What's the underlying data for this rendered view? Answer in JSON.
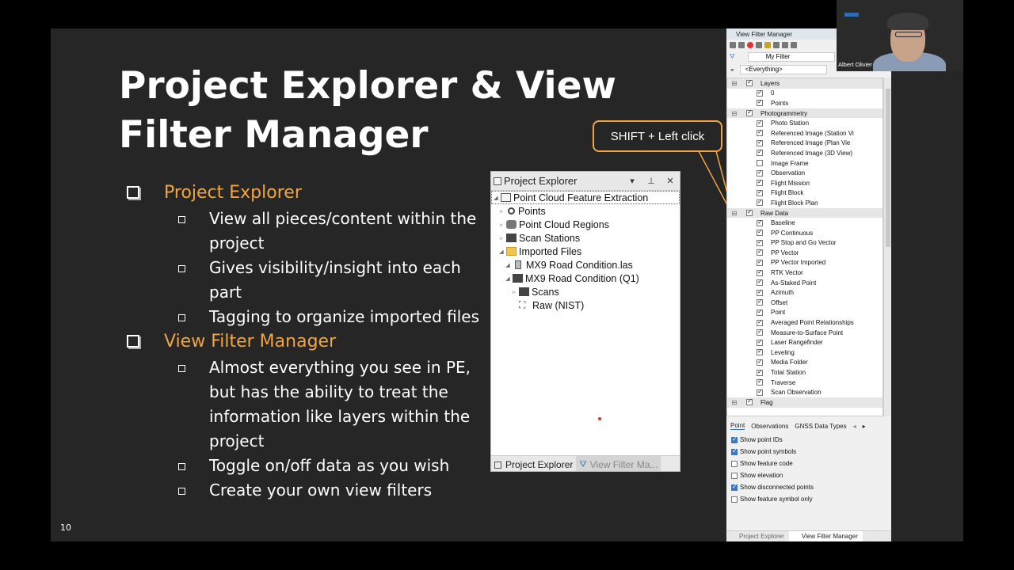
{
  "slide": {
    "title": "Project Explorer & View Filter Manager",
    "slide_number": "10",
    "bullets": [
      {
        "label": "Project Explorer",
        "items": [
          "View all pieces/content within the project",
          "Gives visibility/insight into each part",
          "Tagging to organize imported files"
        ]
      },
      {
        "label": "View Filter Manager",
        "items": [
          "Almost everything you see in PE, but has the ability to treat the information like layers within the project",
          "Toggle on/off data as you wish",
          "Create your own view filters"
        ]
      }
    ],
    "callout": "SHIFT + Left click"
  },
  "project_explorer": {
    "title": "Project Explorer",
    "controls": [
      "▾",
      "⊥",
      "✕"
    ],
    "tree": [
      {
        "label": "Point Cloud Feature Extraction",
        "icon": "document-icon"
      },
      {
        "label": "Points",
        "icon": "points-icon"
      },
      {
        "label": "Point Cloud Regions",
        "icon": "region-icon"
      },
      {
        "label": "Scan Stations",
        "icon": "scan-station-icon"
      },
      {
        "label": "Imported Files",
        "icon": "folder-icon"
      },
      {
        "label": "MX9 Road Condition.las",
        "icon": "file-icon"
      },
      {
        "label": "MX9 Road Condition (Q1)",
        "icon": "scan-station-icon"
      },
      {
        "label": "Scans",
        "icon": "folder-icon"
      },
      {
        "label": "Raw (NIST)",
        "icon": "survey-icon"
      }
    ],
    "tabs": [
      "Project Explorer",
      "View Filter Ma..."
    ]
  },
  "view_filter_manager": {
    "title": "View Filter Manager",
    "filter_name": "My Filter",
    "filter_scope": "<Everything>",
    "groups": [
      {
        "label": "Layers",
        "checked": true,
        "items": [
          {
            "label": "0",
            "checked": true
          },
          {
            "label": "Points",
            "checked": true
          }
        ]
      },
      {
        "label": "Photogrammetry",
        "checked": true,
        "items": [
          {
            "label": "Photo Station",
            "checked": true
          },
          {
            "label": "Referenced Image (Station Vi",
            "checked": true
          },
          {
            "label": "Referenced Image (Plan Vie",
            "checked": true
          },
          {
            "label": "Referenced Image (3D View)",
            "checked": true
          },
          {
            "label": "Image Frame",
            "checked": false
          },
          {
            "label": "Observation",
            "checked": true
          },
          {
            "label": "Flight Mission",
            "checked": true
          },
          {
            "label": "Flight Block",
            "checked": true
          },
          {
            "label": "Flight Block Plan",
            "checked": true
          }
        ]
      },
      {
        "label": "Raw Data",
        "checked": true,
        "items": [
          {
            "label": "Baseline",
            "checked": true
          },
          {
            "label": "PP Continuous",
            "checked": true
          },
          {
            "label": "PP Stop and Go Vector",
            "checked": true
          },
          {
            "label": "PP Vector",
            "checked": true
          },
          {
            "label": "PP Vector Imported",
            "checked": true
          },
          {
            "label": "RTK Vector",
            "checked": true
          },
          {
            "label": "As-Staked Point",
            "checked": true
          },
          {
            "label": "Azimuth",
            "checked": true
          },
          {
            "label": "Offset",
            "checked": true
          },
          {
            "label": "Point",
            "checked": true
          },
          {
            "label": "Averaged Point Relationships",
            "checked": true
          },
          {
            "label": "Measure-to-Surface Point",
            "checked": true
          },
          {
            "label": "Laser Rangefinder",
            "checked": true
          },
          {
            "label": "Leveling",
            "checked": true
          },
          {
            "label": "Media Folder",
            "checked": true
          },
          {
            "label": "Total Station",
            "checked": true
          },
          {
            "label": "Traverse",
            "checked": true
          },
          {
            "label": "Scan Observation",
            "checked": true
          }
        ]
      },
      {
        "label": "Flag",
        "checked": true,
        "items": []
      }
    ],
    "tabs": [
      "Point",
      "Observations",
      "GNSS Data Types"
    ],
    "options": [
      {
        "label": "Show point IDs",
        "checked": true
      },
      {
        "label": "Show point symbols",
        "checked": true
      },
      {
        "label": "Show feature code",
        "checked": false
      },
      {
        "label": "Show elevation",
        "checked": false
      },
      {
        "label": "Show disconnected points",
        "checked": true
      },
      {
        "label": "Show feature symbol only",
        "checked": false
      }
    ],
    "bottom_tabs": [
      "Project Explorer",
      "View Filter Manager"
    ]
  },
  "webcam": {
    "name": "Albert Olivier"
  },
  "colors": {
    "accent": "#f0a540",
    "slide_bg": "#262626"
  }
}
